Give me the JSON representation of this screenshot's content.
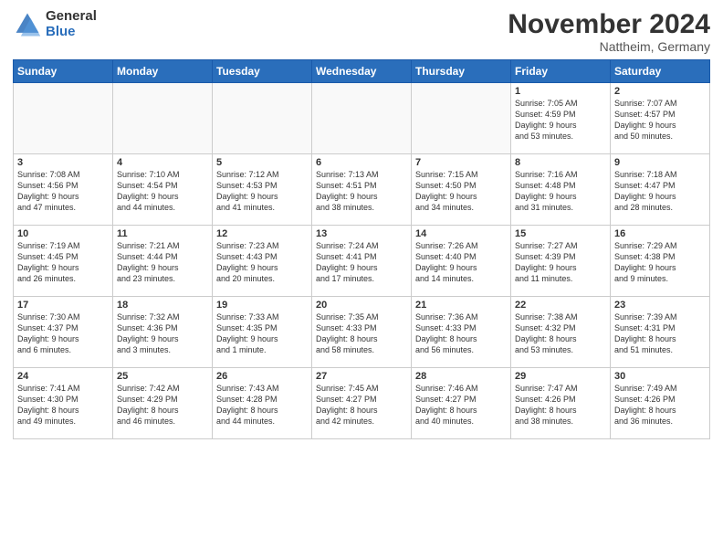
{
  "logo": {
    "general": "General",
    "blue": "Blue"
  },
  "title": "November 2024",
  "location": "Nattheim, Germany",
  "days_header": [
    "Sunday",
    "Monday",
    "Tuesday",
    "Wednesday",
    "Thursday",
    "Friday",
    "Saturday"
  ],
  "weeks": [
    [
      {
        "num": "",
        "info": ""
      },
      {
        "num": "",
        "info": ""
      },
      {
        "num": "",
        "info": ""
      },
      {
        "num": "",
        "info": ""
      },
      {
        "num": "",
        "info": ""
      },
      {
        "num": "1",
        "info": "Sunrise: 7:05 AM\nSunset: 4:59 PM\nDaylight: 9 hours\nand 53 minutes."
      },
      {
        "num": "2",
        "info": "Sunrise: 7:07 AM\nSunset: 4:57 PM\nDaylight: 9 hours\nand 50 minutes."
      }
    ],
    [
      {
        "num": "3",
        "info": "Sunrise: 7:08 AM\nSunset: 4:56 PM\nDaylight: 9 hours\nand 47 minutes."
      },
      {
        "num": "4",
        "info": "Sunrise: 7:10 AM\nSunset: 4:54 PM\nDaylight: 9 hours\nand 44 minutes."
      },
      {
        "num": "5",
        "info": "Sunrise: 7:12 AM\nSunset: 4:53 PM\nDaylight: 9 hours\nand 41 minutes."
      },
      {
        "num": "6",
        "info": "Sunrise: 7:13 AM\nSunset: 4:51 PM\nDaylight: 9 hours\nand 38 minutes."
      },
      {
        "num": "7",
        "info": "Sunrise: 7:15 AM\nSunset: 4:50 PM\nDaylight: 9 hours\nand 34 minutes."
      },
      {
        "num": "8",
        "info": "Sunrise: 7:16 AM\nSunset: 4:48 PM\nDaylight: 9 hours\nand 31 minutes."
      },
      {
        "num": "9",
        "info": "Sunrise: 7:18 AM\nSunset: 4:47 PM\nDaylight: 9 hours\nand 28 minutes."
      }
    ],
    [
      {
        "num": "10",
        "info": "Sunrise: 7:19 AM\nSunset: 4:45 PM\nDaylight: 9 hours\nand 26 minutes."
      },
      {
        "num": "11",
        "info": "Sunrise: 7:21 AM\nSunset: 4:44 PM\nDaylight: 9 hours\nand 23 minutes."
      },
      {
        "num": "12",
        "info": "Sunrise: 7:23 AM\nSunset: 4:43 PM\nDaylight: 9 hours\nand 20 minutes."
      },
      {
        "num": "13",
        "info": "Sunrise: 7:24 AM\nSunset: 4:41 PM\nDaylight: 9 hours\nand 17 minutes."
      },
      {
        "num": "14",
        "info": "Sunrise: 7:26 AM\nSunset: 4:40 PM\nDaylight: 9 hours\nand 14 minutes."
      },
      {
        "num": "15",
        "info": "Sunrise: 7:27 AM\nSunset: 4:39 PM\nDaylight: 9 hours\nand 11 minutes."
      },
      {
        "num": "16",
        "info": "Sunrise: 7:29 AM\nSunset: 4:38 PM\nDaylight: 9 hours\nand 9 minutes."
      }
    ],
    [
      {
        "num": "17",
        "info": "Sunrise: 7:30 AM\nSunset: 4:37 PM\nDaylight: 9 hours\nand 6 minutes."
      },
      {
        "num": "18",
        "info": "Sunrise: 7:32 AM\nSunset: 4:36 PM\nDaylight: 9 hours\nand 3 minutes."
      },
      {
        "num": "19",
        "info": "Sunrise: 7:33 AM\nSunset: 4:35 PM\nDaylight: 9 hours\nand 1 minute."
      },
      {
        "num": "20",
        "info": "Sunrise: 7:35 AM\nSunset: 4:33 PM\nDaylight: 8 hours\nand 58 minutes."
      },
      {
        "num": "21",
        "info": "Sunrise: 7:36 AM\nSunset: 4:33 PM\nDaylight: 8 hours\nand 56 minutes."
      },
      {
        "num": "22",
        "info": "Sunrise: 7:38 AM\nSunset: 4:32 PM\nDaylight: 8 hours\nand 53 minutes."
      },
      {
        "num": "23",
        "info": "Sunrise: 7:39 AM\nSunset: 4:31 PM\nDaylight: 8 hours\nand 51 minutes."
      }
    ],
    [
      {
        "num": "24",
        "info": "Sunrise: 7:41 AM\nSunset: 4:30 PM\nDaylight: 8 hours\nand 49 minutes."
      },
      {
        "num": "25",
        "info": "Sunrise: 7:42 AM\nSunset: 4:29 PM\nDaylight: 8 hours\nand 46 minutes."
      },
      {
        "num": "26",
        "info": "Sunrise: 7:43 AM\nSunset: 4:28 PM\nDaylight: 8 hours\nand 44 minutes."
      },
      {
        "num": "27",
        "info": "Sunrise: 7:45 AM\nSunset: 4:27 PM\nDaylight: 8 hours\nand 42 minutes."
      },
      {
        "num": "28",
        "info": "Sunrise: 7:46 AM\nSunset: 4:27 PM\nDaylight: 8 hours\nand 40 minutes."
      },
      {
        "num": "29",
        "info": "Sunrise: 7:47 AM\nSunset: 4:26 PM\nDaylight: 8 hours\nand 38 minutes."
      },
      {
        "num": "30",
        "info": "Sunrise: 7:49 AM\nSunset: 4:26 PM\nDaylight: 8 hours\nand 36 minutes."
      }
    ]
  ]
}
